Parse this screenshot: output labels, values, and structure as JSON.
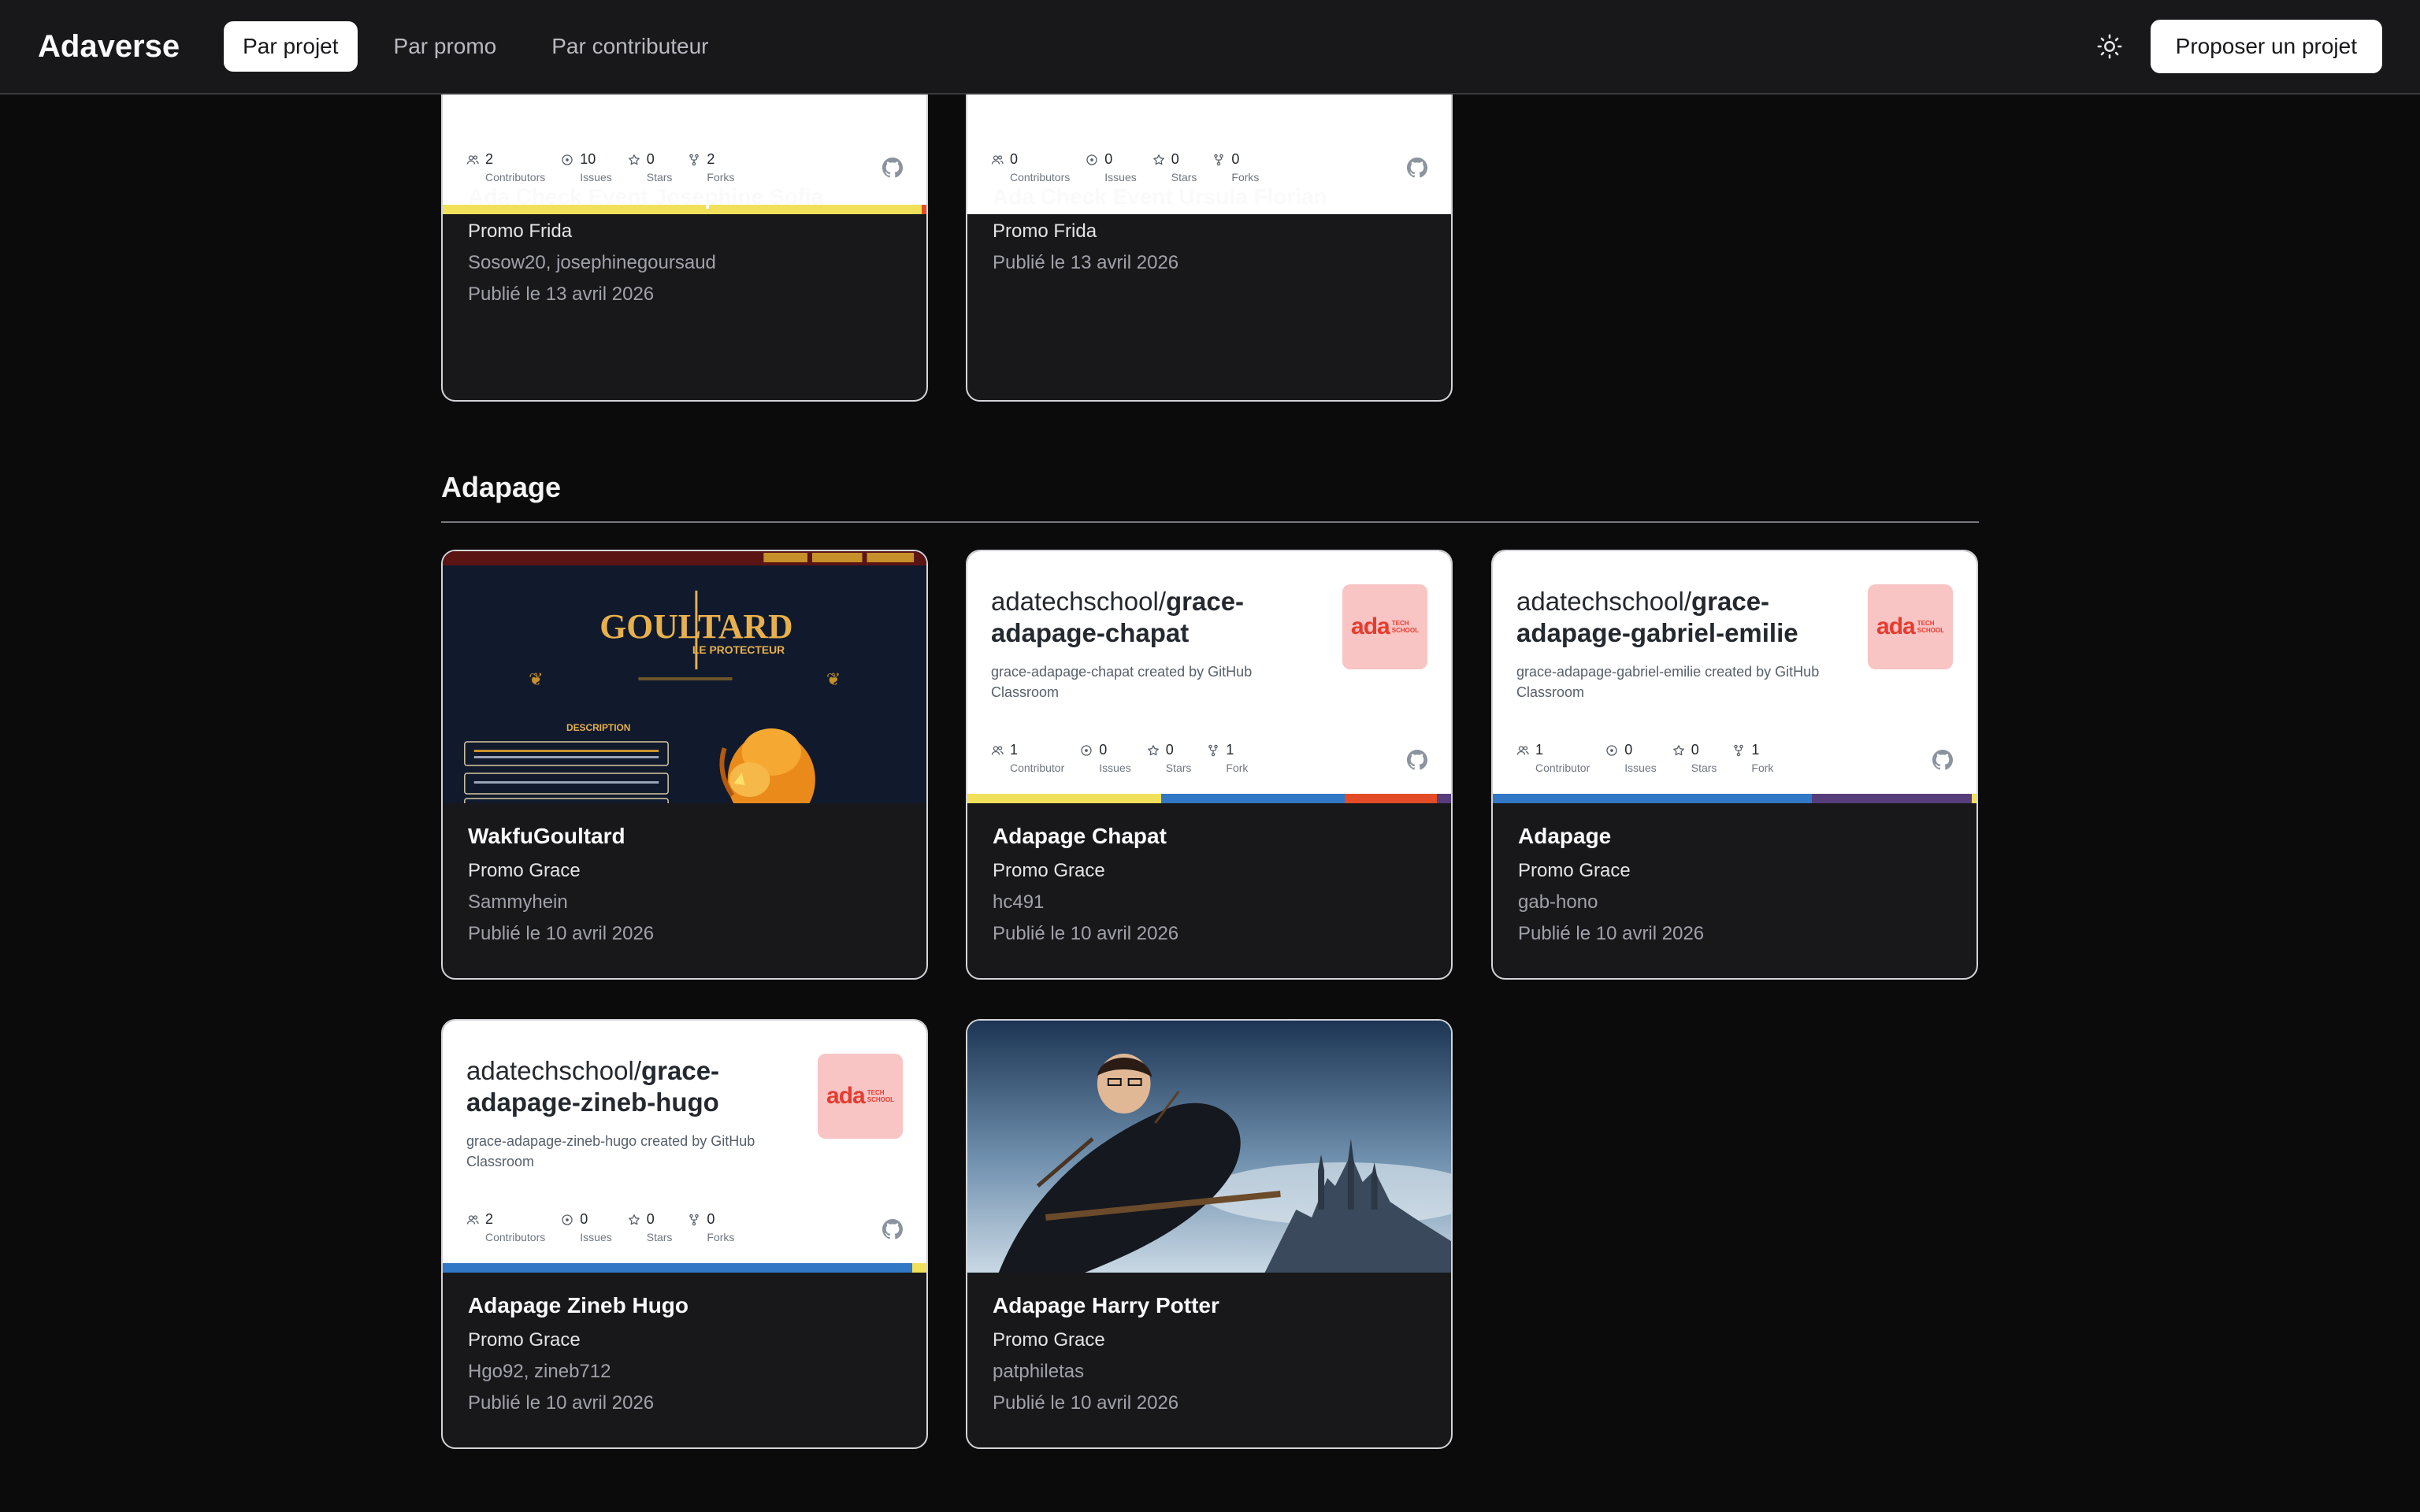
{
  "nav": {
    "brand": "Adaverse",
    "tabs": [
      "Par projet",
      "Par promo",
      "Par contributeur"
    ],
    "propose": "Proposer un projet"
  },
  "colors": {
    "yellow": "#f1e05a",
    "blue": "#3178c6",
    "red": "#e34c26",
    "purple": "#563d7c"
  },
  "top_cards": [
    {
      "stats": [
        [
          "2",
          "Contributors"
        ],
        [
          "10",
          "Issues"
        ],
        [
          "0",
          "Stars"
        ],
        [
          "2",
          "Forks"
        ]
      ],
      "title": "Ada Check Event Josephine Sofia",
      "promo": "Promo Frida",
      "authors": "Sosow20, josephinegoursaud",
      "date": "Publié le 13 avril 2026"
    },
    {
      "stats": [
        [
          "0",
          "Contributors"
        ],
        [
          "0",
          "Issues"
        ],
        [
          "0",
          "Stars"
        ],
        [
          "0",
          "Forks"
        ]
      ],
      "title": "Ada Check Event Ursula Florian",
      "promo": "Promo Frida",
      "date": "Publié le 13 avril 2026"
    }
  ],
  "section": {
    "title": "Adapage",
    "cards": [
      {
        "title": "WakfuGoultard",
        "promo": "Promo Grace",
        "authors": "Sammyhein",
        "date": "Publié le 10 avril 2026",
        "preview": {
          "logo": "GOULTARD",
          "subtitle": "LE PROTECTEUR",
          "section": "DESCRIPTION"
        }
      },
      {
        "title": "Adapage Chapat",
        "promo": "Promo Grace",
        "authors": "hc491",
        "date": "Publié le 10 avril 2026",
        "gh": {
          "owner": "adatechschool/",
          "repo": "grace-adapage-chapat",
          "desc": "grace-adapage-chapat created by GitHub Classroom",
          "logo": "ada",
          "stats": [
            [
              "1",
              "Contributor"
            ],
            [
              "0",
              "Issues"
            ],
            [
              "0",
              "Stars"
            ],
            [
              "1",
              "Fork"
            ]
          ]
        }
      },
      {
        "title": "Adapage",
        "promo": "Promo Grace",
        "authors": "gab-hono",
        "date": "Publié le 10 avril 2026",
        "gh": {
          "owner": "adatechschool/",
          "repo": "grace-adapage-gabriel-emilie",
          "desc": "grace-adapage-gabriel-emilie created by GitHub Classroom",
          "logo": "ada",
          "stats": [
            [
              "1",
              "Contributor"
            ],
            [
              "0",
              "Issues"
            ],
            [
              "0",
              "Stars"
            ],
            [
              "1",
              "Fork"
            ]
          ]
        }
      },
      {
        "title": "Adapage Zineb Hugo",
        "promo": "Promo Grace",
        "authors": "Hgo92, zineb712",
        "date": "Publié le 10 avril 2026",
        "gh": {
          "owner": "adatechschool/",
          "repo": "grace-adapage-zineb-hugo",
          "desc": "grace-adapage-zineb-hugo created by GitHub Classroom",
          "logo": "ada",
          "stats": [
            [
              "2",
              "Contributors"
            ],
            [
              "0",
              "Issues"
            ],
            [
              "0",
              "Stars"
            ],
            [
              "0",
              "Forks"
            ]
          ]
        }
      },
      {
        "title": "Adapage Harry Potter",
        "promo": "Promo Grace",
        "authors": "patphiletas",
        "date": "Publié le 10 avril 2026"
      }
    ]
  }
}
